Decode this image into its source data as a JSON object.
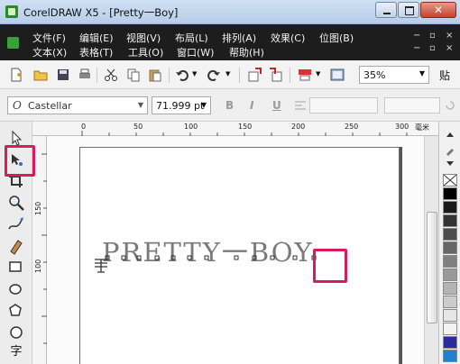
{
  "window": {
    "title": "CorelDRAW X5 - [Pretty一Boy]",
    "close_glyph": "✕"
  },
  "menu": {
    "row1": [
      "文件(F)",
      "编辑(E)",
      "视图(V)",
      "布局(L)",
      "排列(A)",
      "效果(C)",
      "位图(B)"
    ],
    "row2": [
      "文本(X)",
      "表格(T)",
      "工具(O)",
      "窗口(W)",
      "帮助(H)"
    ],
    "controls_row1": [
      "−",
      "▫",
      "×"
    ],
    "controls_row2": [
      "−",
      "▫",
      "×"
    ]
  },
  "toolbar": {
    "zoom_value": "35%",
    "zoom_arrow": "▼",
    "snap_label": "贴"
  },
  "property_bar": {
    "font_glyph": "O",
    "font_name": "Castellar",
    "font_size": "71.999 pt",
    "dropdown_arrow": "▼",
    "bold_label": "B",
    "italic_label": "I",
    "underline_label": "U"
  },
  "ruler": {
    "h_ticks": [
      "0",
      "50",
      "100",
      "150",
      "200",
      "250",
      "300"
    ],
    "v_ticks": [
      "150",
      "100"
    ],
    "units_label": "毫米"
  },
  "canvas": {
    "text_content": "PRETTY一BOY"
  },
  "toolbox": {
    "text_tool_label": "字"
  },
  "palette": {
    "swatch_colors": [
      "#ffffff",
      "#000000",
      "#1a1a1a",
      "#333333",
      "#4d4d4d",
      "#666666",
      "#808080",
      "#999999",
      "#b3b3b3",
      "#cccccc",
      "#e6e6e6",
      "#f2f2f2",
      "#2a2a9a",
      "#1f7fd0"
    ]
  },
  "colors": {
    "highlight": "#d81b5a",
    "menubar_bg": "#1d1d1d"
  }
}
